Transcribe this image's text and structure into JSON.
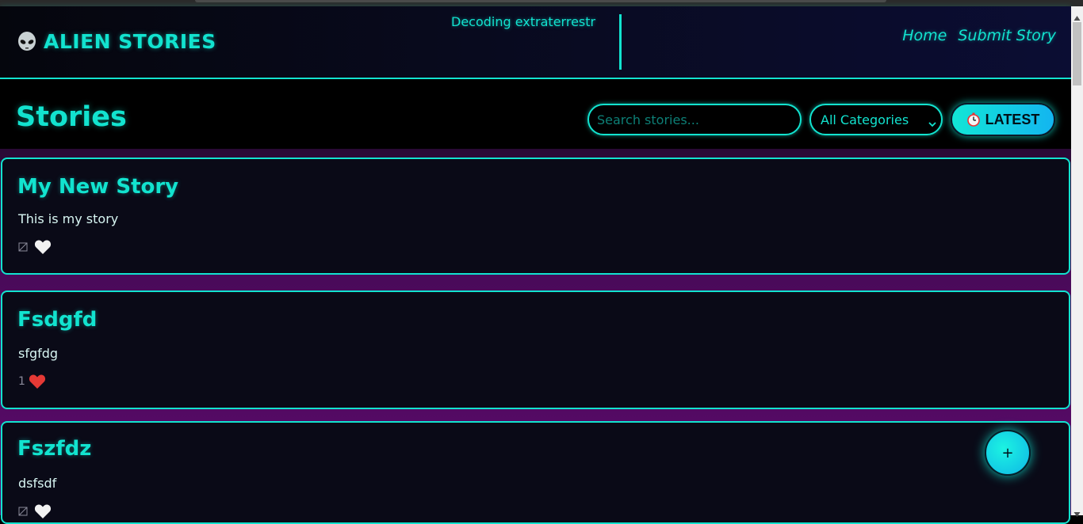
{
  "header": {
    "logo_text": "ALIEN STORIES",
    "logo_icon": "alien-icon",
    "ticker_text": "Decoding extraterrestr",
    "nav": [
      {
        "label": "Home"
      },
      {
        "label": "Submit Story"
      }
    ]
  },
  "toolbar": {
    "title": "Stories",
    "search_placeholder": "Search stories...",
    "category_selected": "All Categories",
    "sort_label": "LATEST",
    "sort_icon": "timer-icon"
  },
  "stories": [
    {
      "title": "My New Story",
      "body": "This is my story",
      "likes": "",
      "liked": false
    },
    {
      "title": "Fsdgfd",
      "body": "sfgfdg",
      "likes": "1",
      "liked": true
    },
    {
      "title": "Fszfdz",
      "body": "dsfsdf",
      "likes": "",
      "liked": false
    }
  ],
  "fab": {
    "label": "+"
  },
  "colors": {
    "accent": "#12e3cf",
    "background": "#000000",
    "card": "#0a0a17",
    "feed_glow": "#5a0a6a",
    "heart_liked": "#e53935",
    "heart_unliked": "#f2f2f2"
  }
}
